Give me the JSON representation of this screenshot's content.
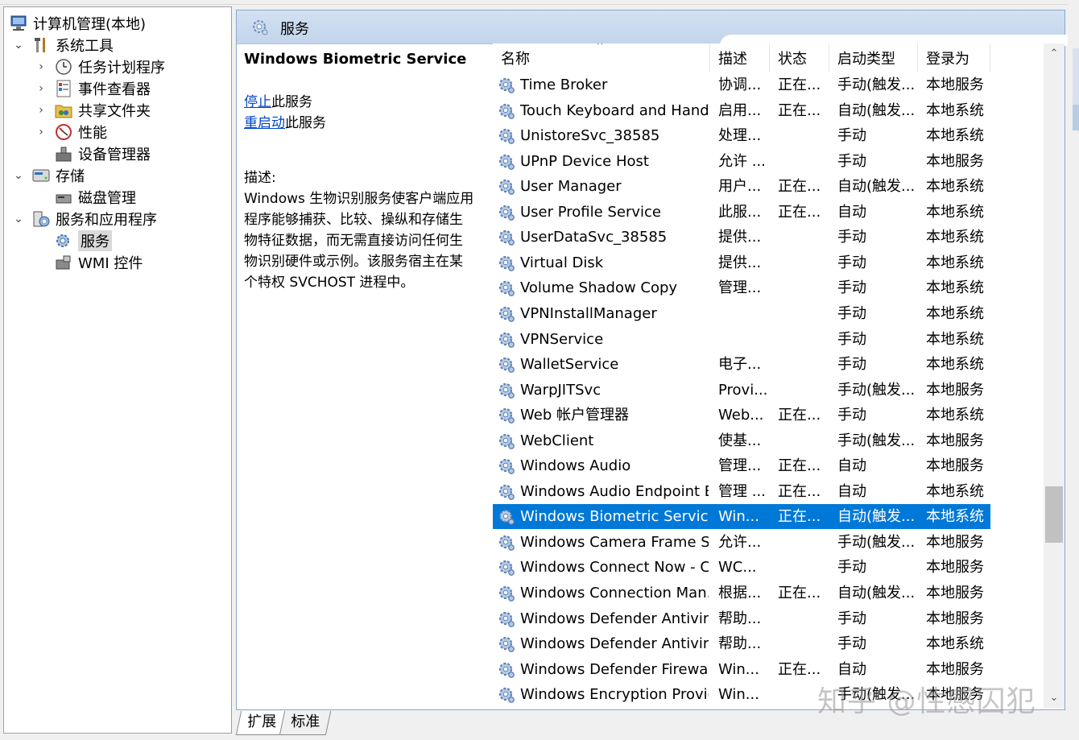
{
  "tree": {
    "root": "计算机管理(本地)",
    "system_tools": "系统工具",
    "task_scheduler": "任务计划程序",
    "event_viewer": "事件查看器",
    "shared_folders": "共享文件夹",
    "performance": "性能",
    "device_manager": "设备管理器",
    "storage": "存储",
    "disk_management": "磁盘管理",
    "services_apps": "服务和应用程序",
    "services": "服务",
    "wmi": "WMI 控件"
  },
  "header": {
    "title": "服务"
  },
  "detail": {
    "service_name": "Windows Biometric Service",
    "stop_link": "停止",
    "stop_suffix": "此服务",
    "restart_link": "重启动",
    "restart_suffix": "此服务",
    "desc_label": "描述:",
    "desc_lines": [
      "Windows 生物识别服务使客户端应用",
      "程序能够捕获、比较、操纵和存储生",
      "物特征数据，而无需直接访问任何生",
      "物识别硬件或示例。该服务宿主在某",
      "个特权 SVCHOST 进程中。"
    ]
  },
  "columns": {
    "name": "名称",
    "desc": "描述",
    "status": "状态",
    "startup": "启动类型",
    "logon": "登录为",
    "sort_caret": "^"
  },
  "rows": [
    {
      "name": "Time Broker",
      "desc": "协调...",
      "status": "正在...",
      "startup": "手动(触发...",
      "logon": "本地服务"
    },
    {
      "name": "Touch Keyboard and Hand...",
      "desc": "启用...",
      "status": "正在...",
      "startup": "自动(触发...",
      "logon": "本地系统"
    },
    {
      "name": "UnistoreSvc_38585",
      "desc": "处理...",
      "status": "",
      "startup": "手动",
      "logon": "本地系统"
    },
    {
      "name": "UPnP Device Host",
      "desc": "允许 ...",
      "status": "",
      "startup": "手动",
      "logon": "本地服务"
    },
    {
      "name": "User Manager",
      "desc": "用户...",
      "status": "正在...",
      "startup": "自动(触发...",
      "logon": "本地系统"
    },
    {
      "name": "User Profile Service",
      "desc": "此服...",
      "status": "正在...",
      "startup": "自动",
      "logon": "本地系统"
    },
    {
      "name": "UserDataSvc_38585",
      "desc": "提供...",
      "status": "",
      "startup": "手动",
      "logon": "本地系统"
    },
    {
      "name": "Virtual Disk",
      "desc": "提供...",
      "status": "",
      "startup": "手动",
      "logon": "本地系统"
    },
    {
      "name": "Volume Shadow Copy",
      "desc": "管理...",
      "status": "",
      "startup": "手动",
      "logon": "本地系统"
    },
    {
      "name": "VPNInstallManager",
      "desc": "",
      "status": "",
      "startup": "手动",
      "logon": "本地系统"
    },
    {
      "name": "VPNService",
      "desc": "",
      "status": "",
      "startup": "手动",
      "logon": "本地系统"
    },
    {
      "name": "WalletService",
      "desc": "电子...",
      "status": "",
      "startup": "手动",
      "logon": "本地系统"
    },
    {
      "name": "WarpJITSvc",
      "desc": "Provi...",
      "status": "",
      "startup": "手动(触发...",
      "logon": "本地服务"
    },
    {
      "name": "Web 帐户管理器",
      "desc": "Web...",
      "status": "正在...",
      "startup": "手动",
      "logon": "本地系统"
    },
    {
      "name": "WebClient",
      "desc": "使基...",
      "status": "",
      "startup": "手动(触发...",
      "logon": "本地服务"
    },
    {
      "name": "Windows Audio",
      "desc": "管理...",
      "status": "正在...",
      "startup": "自动",
      "logon": "本地服务"
    },
    {
      "name": "Windows Audio Endpoint B...",
      "desc": "管理 ...",
      "status": "正在...",
      "startup": "自动",
      "logon": "本地系统"
    },
    {
      "name": "Windows Biometric Service",
      "desc": "Win...",
      "status": "正在...",
      "startup": "自动(触发...",
      "logon": "本地系统",
      "selected": true
    },
    {
      "name": "Windows Camera Frame S...",
      "desc": "允许...",
      "status": "",
      "startup": "手动(触发...",
      "logon": "本地服务"
    },
    {
      "name": "Windows Connect Now - C...",
      "desc": "WC...",
      "status": "",
      "startup": "手动",
      "logon": "本地服务"
    },
    {
      "name": "Windows Connection Man...",
      "desc": "根据...",
      "status": "正在...",
      "startup": "自动(触发...",
      "logon": "本地服务"
    },
    {
      "name": "Windows Defender Antivir...",
      "desc": "帮助...",
      "status": "",
      "startup": "手动",
      "logon": "本地服务"
    },
    {
      "name": "Windows Defender Antivir...",
      "desc": "帮助...",
      "status": "",
      "startup": "手动",
      "logon": "本地系统"
    },
    {
      "name": "Windows Defender Firewall",
      "desc": "Win...",
      "status": "正在...",
      "startup": "自动",
      "logon": "本地服务"
    },
    {
      "name": "Windows Encryption Provid...",
      "desc": "Win...",
      "status": "",
      "startup": "手动(触发...",
      "logon": "本地服务"
    }
  ],
  "tabs": {
    "extended": "扩展",
    "standard": "标准"
  },
  "scrollbar": {
    "up": "⌃",
    "down": "⌄"
  },
  "watermark": "知乎 @性感囚犯"
}
